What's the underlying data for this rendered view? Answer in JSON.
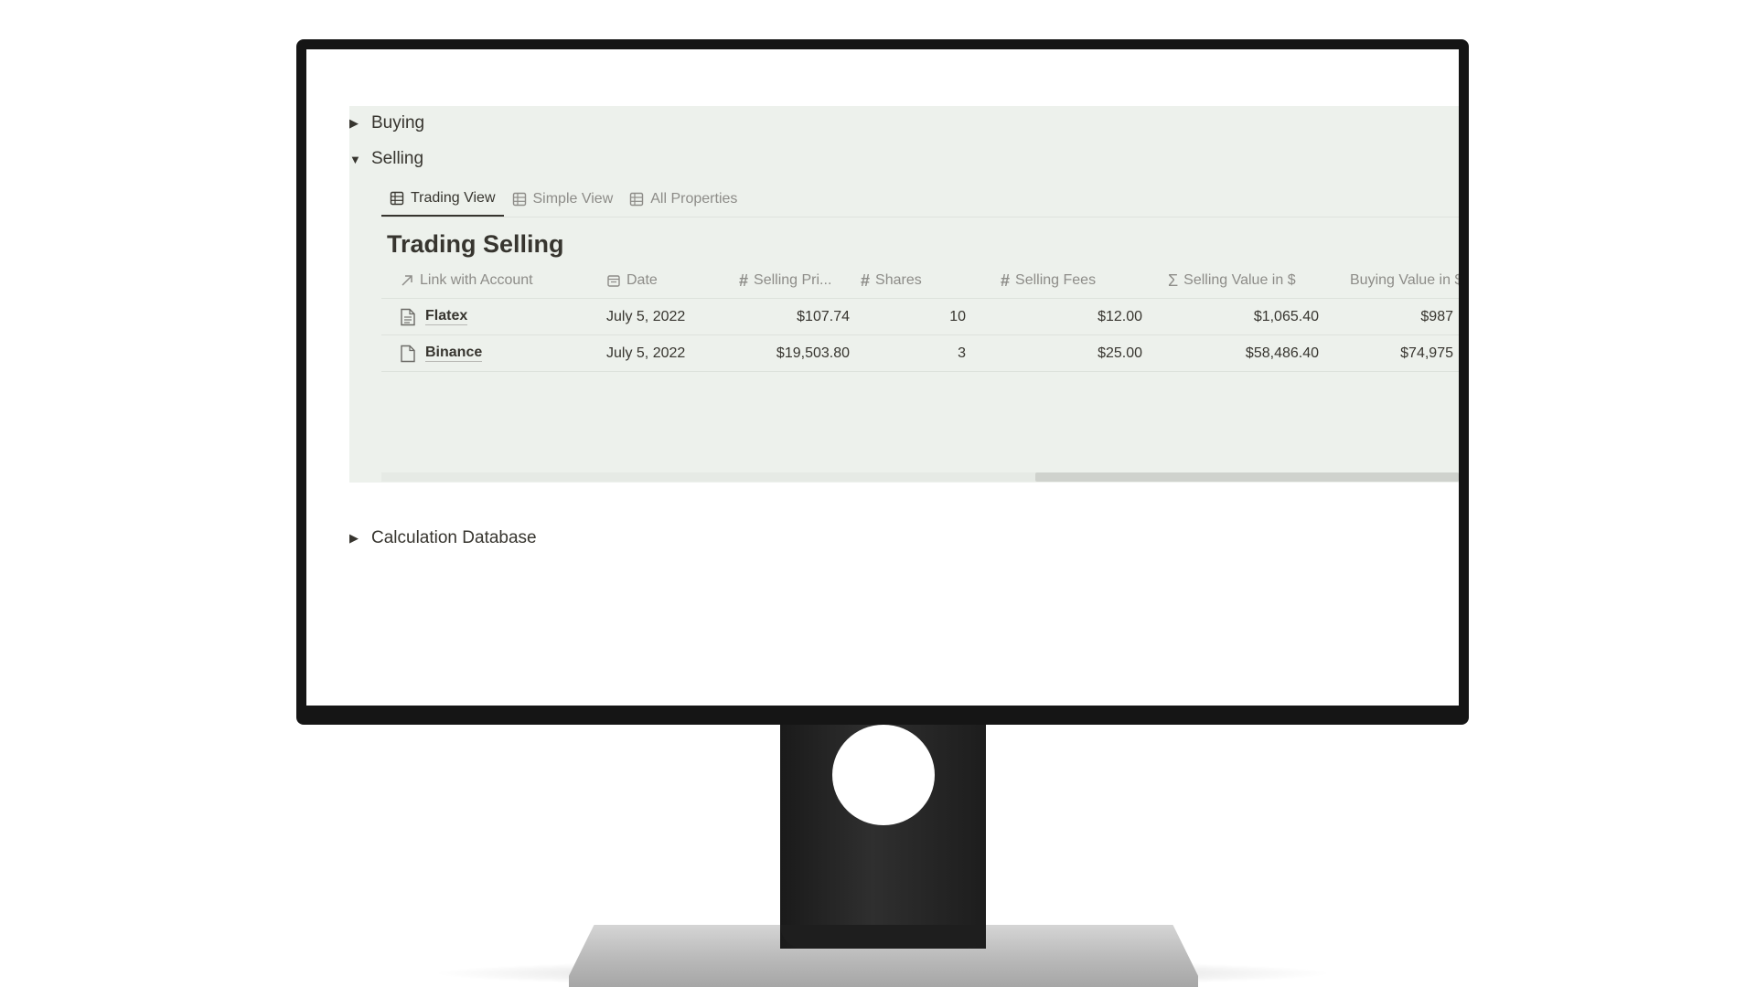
{
  "sections": {
    "buying": "Buying",
    "selling": "Selling",
    "calculation": "Calculation Database"
  },
  "tabs": [
    {
      "label": "Trading View",
      "icon": "table-icon",
      "active": true
    },
    {
      "label": "Simple View",
      "icon": "table-icon",
      "active": false
    },
    {
      "label": "All Properties",
      "icon": "table-icon",
      "active": false
    }
  ],
  "database": {
    "title": "Trading Selling",
    "columns": [
      {
        "label": "Link with Account",
        "icon": "arrow-up-right-icon"
      },
      {
        "label": "Date",
        "icon": "calendar-icon"
      },
      {
        "label": "Selling Pri...",
        "icon": "hash-icon"
      },
      {
        "label": "Shares",
        "icon": "hash-icon"
      },
      {
        "label": "Selling Fees",
        "icon": "hash-icon"
      },
      {
        "label": "Selling Value in $",
        "icon": "sigma-icon"
      },
      {
        "label": "Buying Value in $",
        "icon": "search-icon"
      }
    ],
    "rows": [
      {
        "name": "Flatex",
        "date": "July 5, 2022",
        "price": "$107.74",
        "shares": "10",
        "fees": "$12.00",
        "selling_value": "$1,065.40",
        "buying_value": "$987"
      },
      {
        "name": "Binance",
        "date": "July 5, 2022",
        "price": "$19,503.80",
        "shares": "3",
        "fees": "$25.00",
        "selling_value": "$58,486.40",
        "buying_value": "$74,975"
      }
    ]
  },
  "colors": {
    "accent_background": "#edf1ec",
    "text": "#37352f",
    "muted_text": "#8d8c88"
  }
}
